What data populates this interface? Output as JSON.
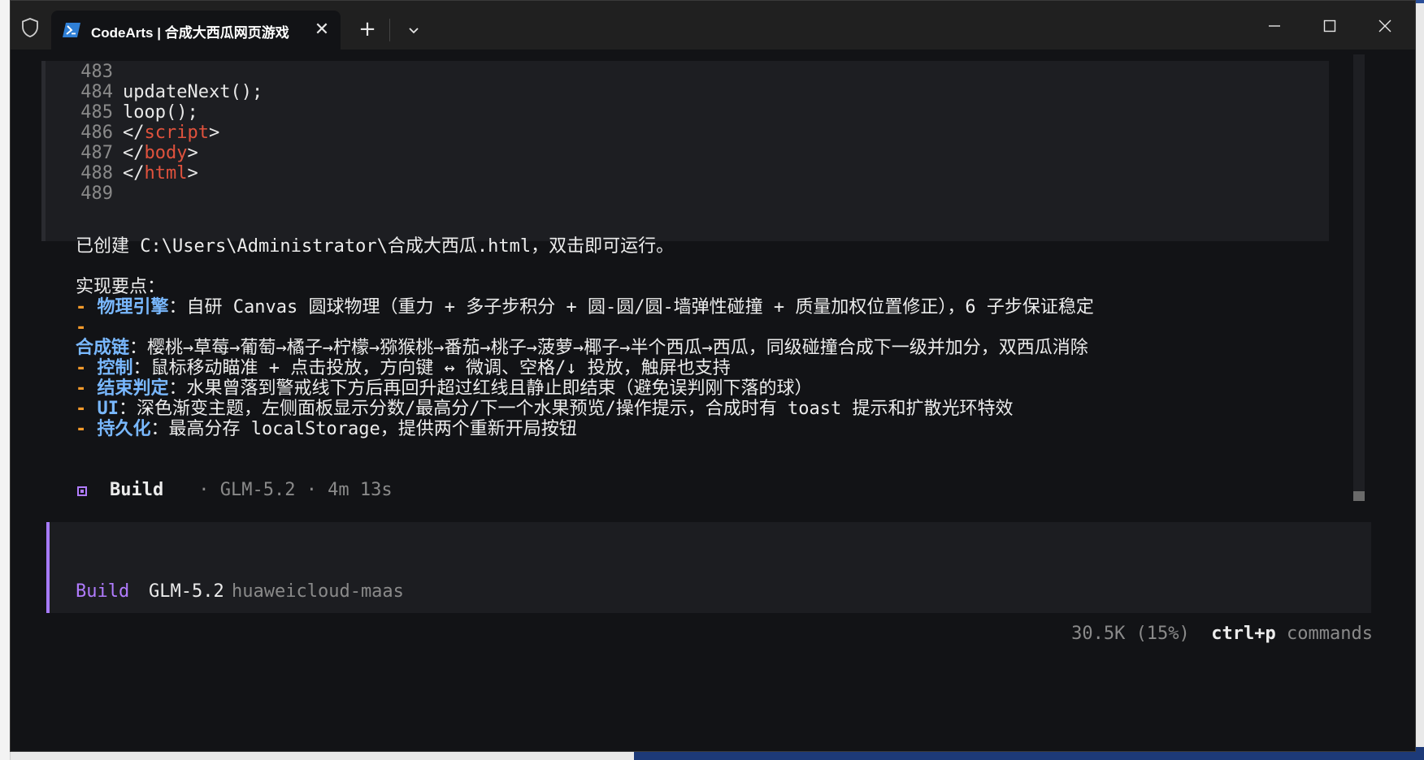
{
  "window": {
    "tab_title": "CodeArts | 合成大西瓜网页游戏",
    "tab_close": "✕",
    "new_tab": "+"
  },
  "code": {
    "lines": [
      {
        "num": "483",
        "text": ""
      },
      {
        "num": "484",
        "text": "updateNext();"
      },
      {
        "num": "485",
        "text": "loop();"
      },
      {
        "num": "486",
        "pre": "</",
        "tag": "script",
        "post": ">"
      },
      {
        "num": "487",
        "pre": "</",
        "tag": "body",
        "post": ">"
      },
      {
        "num": "488",
        "pre": "</",
        "tag": "html",
        "post": ">"
      },
      {
        "num": "489",
        "text": ""
      }
    ]
  },
  "message": {
    "created": "已创建 C:\\Users\\Administrator\\合成大西瓜.html，双击即可运行。",
    "heading": "实现要点：",
    "bullet_dash": "- ",
    "points": [
      {
        "key": "物理引擎",
        "text": "：自研 Canvas 圆球物理（重力 + 多子步积分 + 圆-圆/圆-墙弹性碰撞 + 质量加权位置修正），6 子步保证稳定"
      },
      {
        "key": "合成链",
        "text": "：樱桃→草莓→葡萄→橘子→柠檬→猕猴桃→番茄→桃子→菠萝→椰子→半个西瓜→西瓜，同级碰撞合成下一级并加分，双西瓜消除"
      },
      {
        "key": "控制",
        "text": "：鼠标移动瞄准 + 点击投放，方向键 ↔ 微调、空格/↓ 投放，触屏也支持"
      },
      {
        "key": "结束判定",
        "text": "：水果曾落到警戒线下方后再回升超过红线且静止即结束（避免误判刚下落的球）"
      },
      {
        "key": "UI",
        "text": "：深色渐变主题，左侧面板显示分数/最高分/下一个水果预览/操作提示，合成时有 toast 提示和扩散光环特效"
      },
      {
        "key": "持久化",
        "text": "：最高分存 localStorage，提供两个重新开局按钮"
      }
    ]
  },
  "build": {
    "label": "Build",
    "meta": " · GLM-5.2 · 4m 13s"
  },
  "input": {
    "mode": "Build",
    "model": "GLM-5.2",
    "provider": "huaweicloud-maas"
  },
  "status": {
    "tokens": "30.5K (15%)",
    "shortcut": "ctrl+p",
    "commands": " commands"
  },
  "colors": {
    "accent_purple": "#b17cff",
    "bullet_orange": "#f59a2b",
    "key_blue": "#79b8ff",
    "tag_red": "#e0523d",
    "background": "#121316"
  }
}
